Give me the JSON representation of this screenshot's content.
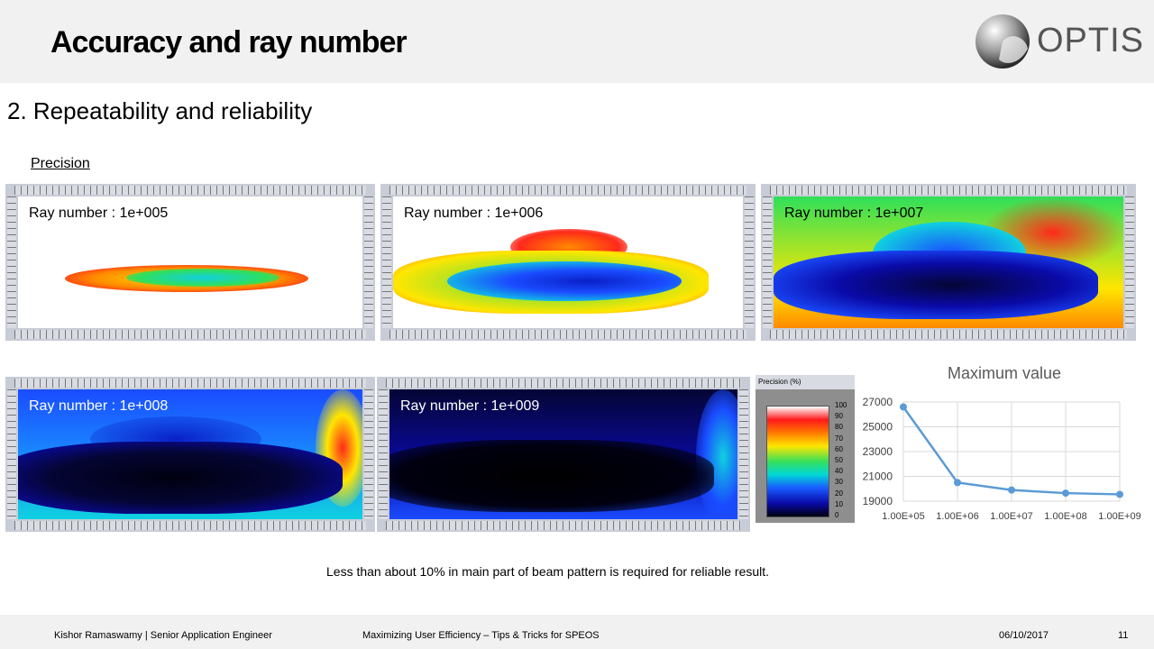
{
  "header": {
    "title": "Accuracy and ray number",
    "logo_text": "OPTIS"
  },
  "subtitle": "2. Repeatability and reliability",
  "section_label": "Precision",
  "maps": [
    {
      "label": "Ray number : 1e+005",
      "level": 0.1
    },
    {
      "label": "Ray number : 1e+006",
      "level": 0.3
    },
    {
      "label": "Ray number : 1e+007",
      "level": 0.55
    },
    {
      "label": "Ray number : 1e+008",
      "level": 0.8
    },
    {
      "label": "Ray number : 1e+009",
      "level": 0.95
    }
  ],
  "colors": {
    "red": "#ff2a1a",
    "orange": "#ff8a00",
    "yellow": "#ffe600",
    "green": "#2fe05a",
    "cyan": "#10d0e0",
    "blue": "#1a4cff",
    "navy": "#050535"
  },
  "precision_scale": {
    "header": "Precision (%)",
    "ticks": [
      "100",
      "90",
      "80",
      "70",
      "60",
      "50",
      "40",
      "30",
      "20",
      "10",
      "0"
    ]
  },
  "chart_data": {
    "type": "line",
    "title": "Maximum value",
    "categories": [
      "1.00E+05",
      "1.00E+06",
      "1.00E+07",
      "1.00E+08",
      "1.00E+09"
    ],
    "series": [
      {
        "values": [
          26600,
          20500,
          19900,
          19650,
          19550
        ]
      }
    ],
    "y_ticks": [
      27000,
      25000,
      23000,
      21000,
      19000
    ],
    "ylim": [
      19000,
      27000
    ],
    "grid": true,
    "color": "#5b9bd5"
  },
  "note": "Less than about 10% in main part of beam pattern is required for reliable result.",
  "footer": {
    "author": "Kishor Ramaswamy | Senior Application Engineer",
    "talk": "Maximizing User Efficiency – Tips & Tricks for SPEOS",
    "date": "06/10/2017",
    "page": "11"
  }
}
